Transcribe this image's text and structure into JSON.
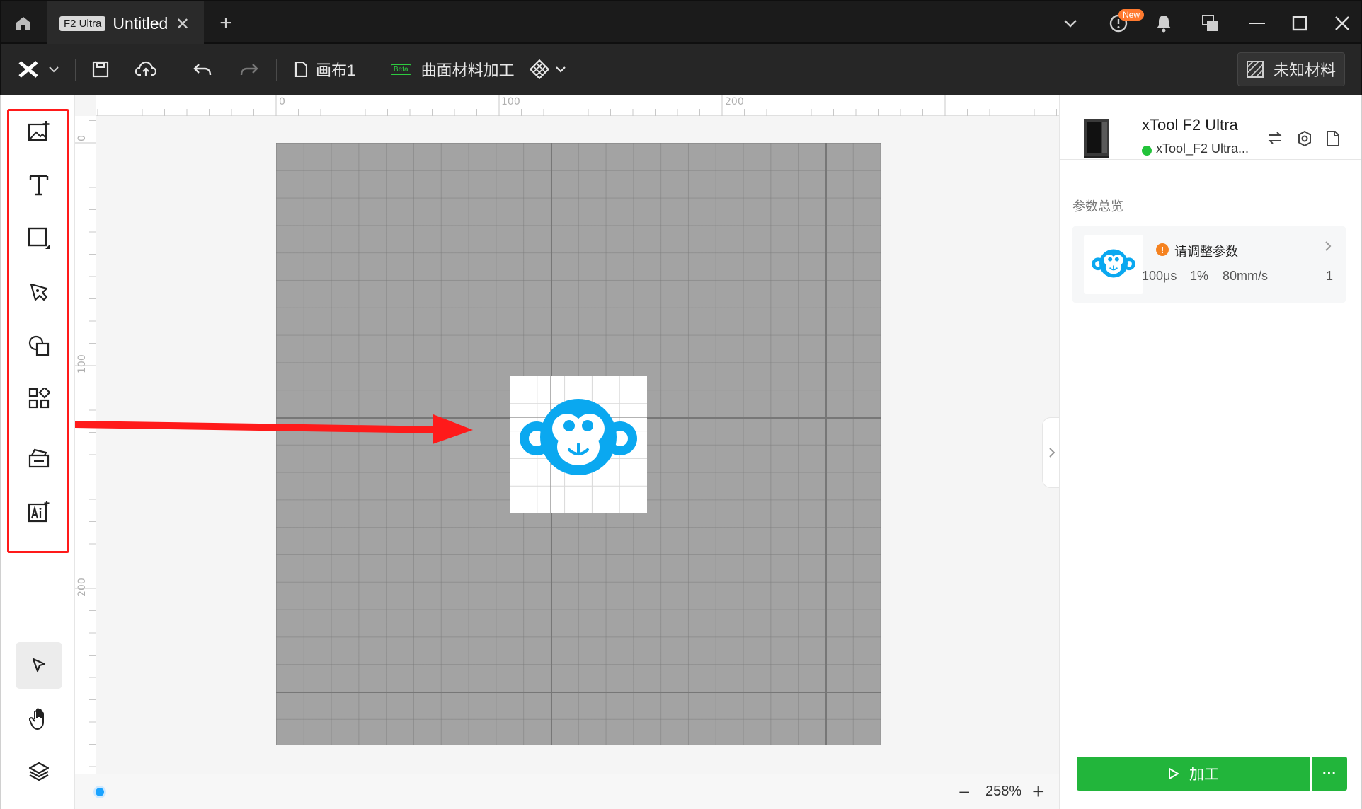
{
  "titlebar": {
    "tab_badge": "F2 Ultra",
    "tab_title": "Untitled",
    "tab_close": "✕",
    "add_tab": "+",
    "new_badge": "New"
  },
  "toolbar": {
    "canvas_name": "画布1",
    "beta_label": "Beta",
    "curve_mode": "曲面材料加工",
    "material_label": "未知材料"
  },
  "ruler": {
    "top": [
      "0",
      "100",
      "200"
    ],
    "left": [
      "0",
      "100",
      "200"
    ]
  },
  "status": {
    "zoom_out": "−",
    "zoom": "258%",
    "zoom_in": "+"
  },
  "device": {
    "name": "xTool F2 Ultra",
    "connection": "xTool_F2 Ultra...",
    "status_color": "#22c33a"
  },
  "params": {
    "title": "参数总览",
    "warning": "请调整参数",
    "values": [
      "100μs",
      "1%",
      "80mm/s",
      "1"
    ]
  },
  "actions": {
    "process_label": "加工",
    "more_label": "···"
  },
  "colors": {
    "accent": "#22b53b",
    "highlight": "#ff1a1a",
    "logo_blue": "#0aa8f0"
  }
}
